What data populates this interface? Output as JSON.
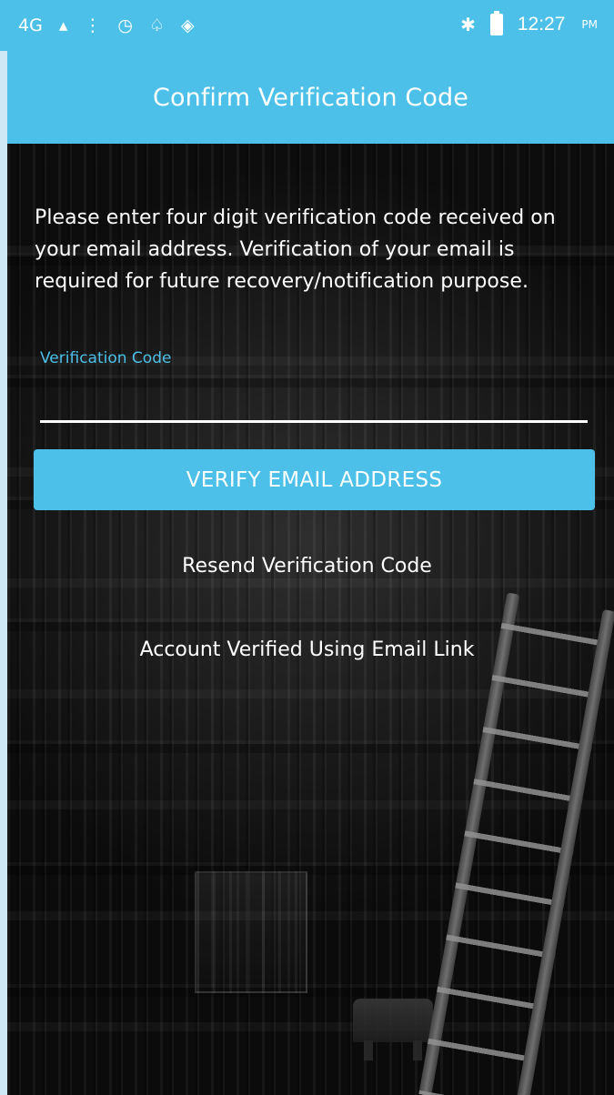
{
  "status_bar": {
    "signal_label": "4G",
    "time": "12:27",
    "am_pm": "PM",
    "icons": [
      "signal-icon",
      "dots-icon",
      "alarm-icon",
      "notification-bell-icon",
      "shield-icon",
      "bluetooth-icon",
      "battery-icon"
    ]
  },
  "header": {
    "title": "Confirm Verification Code"
  },
  "content": {
    "intro_text": "Please enter four digit verification code received on your email address. Verification of your email is required for future recovery/notification purpose.",
    "verification_label": "Verification Code",
    "verification_value": "",
    "verify_button": "VERIFY EMAIL ADDRESS",
    "resend_link": "Resend Verification Code",
    "verified_link": "Account Verified Using Email Link"
  },
  "colors": {
    "accent": "#4cc0e8",
    "text": "#ffffff",
    "background": "#111111"
  }
}
